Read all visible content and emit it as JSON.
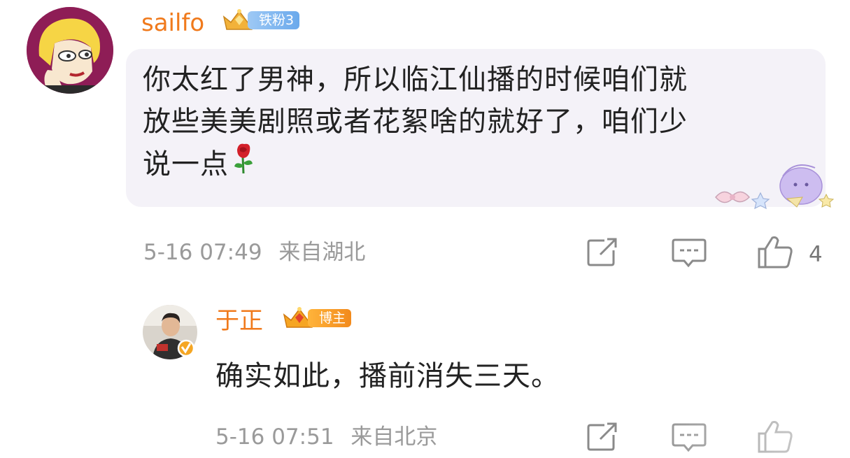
{
  "comment": {
    "username": "sailfo",
    "fan_badge": "铁粉3",
    "text": "你太红了男神，所以临江仙播的时候咱们就放些美美剧照或者花絮啥的就好了，咱们少说一点",
    "text_lines": [
      "你太红了男神，所以临江仙播的时候咱们就",
      "放些美美剧照或者花絮啥的就好了，咱们少",
      "说一点"
    ],
    "emoji": "rose-emoji",
    "timestamp": "5-16 07:49",
    "location": "来自湖北",
    "like_count": "4"
  },
  "reply": {
    "username": "于正",
    "role_badge": "博主",
    "text": "确实如此，播前消失三天。",
    "timestamp": "5-16 07:51",
    "location": "来自北京"
  },
  "colors": {
    "username": "#f07a1c",
    "bubble_bg": "#f4f2f8",
    "meta_text": "#9a9a9a"
  }
}
